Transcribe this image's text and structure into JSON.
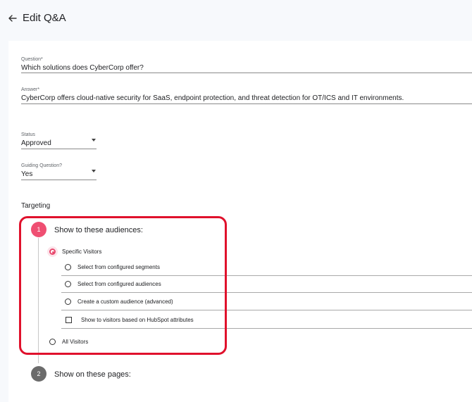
{
  "header": {
    "title": "Edit Q&A"
  },
  "question": {
    "label": "Question*",
    "value": "Which solutions does CyberCorp offer?"
  },
  "answer": {
    "label": "Answer*",
    "value": "CyberCorp offers cloud-native security for SaaS, endpoint protection, and threat detection for OT/ICS and IT environments."
  },
  "status": {
    "label": "Status",
    "value": "Approved"
  },
  "guiding": {
    "label": "Guiding Question?",
    "value": "Yes"
  },
  "targeting": {
    "label": "Targeting",
    "step1": {
      "number": "1",
      "title": "Show to these audiences:"
    },
    "specific_visitors": "Specific Visitors",
    "options": [
      "Select from configured segments",
      "Select from configured audiences",
      "Create a custom audience (advanced)"
    ],
    "hubspot_checkbox": "Show to visitors based on HubSpot attributes",
    "all_visitors": "All Visitors",
    "step2": {
      "number": "2",
      "title": "Show on these pages:"
    },
    "selected_audience": "Specific Visitors"
  },
  "colors": {
    "accent": "#e8476c",
    "highlight": "#e0112c",
    "step2": "#6b6b6b"
  }
}
